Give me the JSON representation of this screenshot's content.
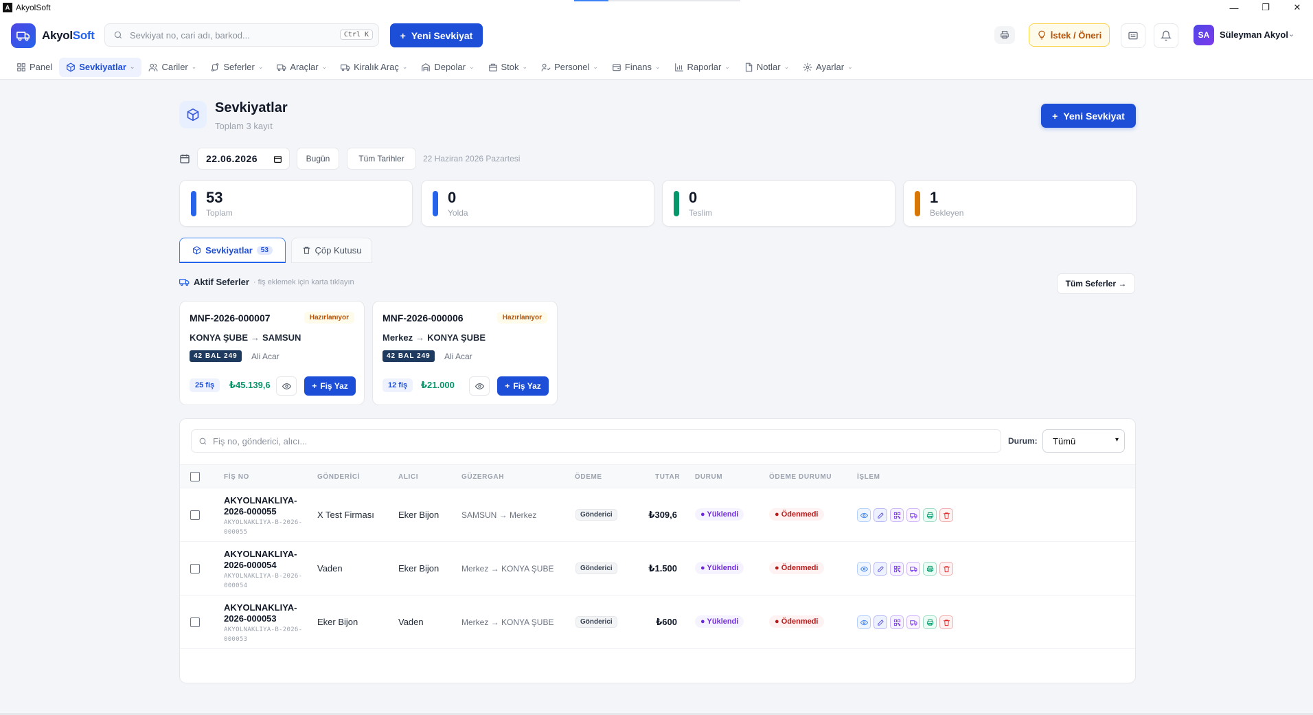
{
  "window": {
    "title": "AkyolSoft"
  },
  "header": {
    "logo_prefix": "Akyol",
    "logo_suffix": "Soft",
    "search_placeholder": "Sevkiyat no, cari adı, barkod...",
    "search_shortcut": "Ctrl K",
    "new_shipment": "Yeni Sevkiyat",
    "suggest": "İstek / Öneri",
    "user_initials": "SA",
    "user_name": "Süleyman Akyol"
  },
  "nav": [
    {
      "label": "Panel",
      "icon": "grid-icon",
      "chev": false
    },
    {
      "label": "Sevkiyatlar",
      "icon": "box-icon",
      "chev": true,
      "active": true
    },
    {
      "label": "Cariler",
      "icon": "users-icon",
      "chev": true
    },
    {
      "label": "Seferler",
      "icon": "route-icon",
      "chev": true
    },
    {
      "label": "Araçlar",
      "icon": "truck-icon",
      "chev": true
    },
    {
      "label": "Kiralık Araç",
      "icon": "truck-icon",
      "chev": true
    },
    {
      "label": "Depolar",
      "icon": "warehouse-icon",
      "chev": true
    },
    {
      "label": "Stok",
      "icon": "package-icon",
      "chev": true
    },
    {
      "label": "Personel",
      "icon": "user-icon",
      "chev": true
    },
    {
      "label": "Finans",
      "icon": "wallet-icon",
      "chev": true
    },
    {
      "label": "Raporlar",
      "icon": "chart-icon",
      "chev": true
    },
    {
      "label": "Notlar",
      "icon": "note-icon",
      "chev": true
    },
    {
      "label": "Ayarlar",
      "icon": "gear-icon",
      "chev": true
    }
  ],
  "page": {
    "title": "Sevkiyatlar",
    "subtitle": "Toplam 3 kayıt",
    "new_button": "Yeni Sevkiyat",
    "date_value": "22.06.2026",
    "today_button": "Bugün",
    "all_dates_button": "Tüm Tarihler",
    "date_label": "22 Haziran 2026 Pazartesi"
  },
  "stats": [
    {
      "value": "53",
      "label": "Toplam",
      "color": "#2563eb"
    },
    {
      "value": "0",
      "label": "Yolda",
      "color": "#2563eb"
    },
    {
      "value": "0",
      "label": "Teslim",
      "color": "#059669"
    },
    {
      "value": "1",
      "label": "Bekleyen",
      "color": "#d97706"
    }
  ],
  "tabs": {
    "shipments": "Sevkiyatlar",
    "shipments_count": "53",
    "trash": "Çöp Kutusu"
  },
  "active_trips": {
    "title": "Aktif Seferler",
    "hint": "· fiş eklemek için karta tıklayın",
    "all_button": "Tüm Seferler →",
    "cards": [
      {
        "code": "MNF-2026-000007",
        "status": "Hazırlanıyor",
        "from": "KONYA ŞUBE",
        "to": "SAMSUN",
        "plate": "42 BAL 249",
        "driver": "Ali Acar",
        "fis_count": "25 fiş",
        "amount": "₺45.139,6",
        "button": "Fiş Yaz"
      },
      {
        "code": "MNF-2026-000006",
        "status": "Hazırlanıyor",
        "from": "Merkez",
        "to": "KONYA ŞUBE",
        "plate": "42 BAL 249",
        "driver": "Ali Acar",
        "fis_count": "12 fiş",
        "amount": "₺21.000",
        "button": "Fiş Yaz"
      }
    ]
  },
  "table": {
    "search_placeholder": "Fiş no, gönderici, alıcı...",
    "status_label": "Durum:",
    "status_value": "Tümü",
    "columns": [
      "FİŞ NO",
      "GÖNDERİCİ",
      "ALICI",
      "GÜZERGAH",
      "ÖDEME",
      "TUTAR",
      "DURUM",
      "ÖDEME DURUMU",
      "İŞLEM"
    ],
    "rows": [
      {
        "fis_no": "AKYOLNAKLIYA-2026-000055",
        "fis_sub": "AKYOLNAKLIYA-B-2026-000055",
        "sender": "X Test Firması",
        "receiver": "Eker Bijon",
        "route": "SAMSUN → Merkez",
        "payment": "Gönderici",
        "amount": "₺309,6",
        "status": "Yüklendi",
        "pay_status": "Ödenmedi"
      },
      {
        "fis_no": "AKYOLNAKLIYA-2026-000054",
        "fis_sub": "AKYOLNAKLIYA-B-2026-000054",
        "sender": "Vaden",
        "receiver": "Eker Bijon",
        "route": "Merkez → KONYA ŞUBE",
        "payment": "Gönderici",
        "amount": "₺1.500",
        "status": "Yüklendi",
        "pay_status": "Ödenmedi"
      },
      {
        "fis_no": "AKYOLNAKLIYA-2026-000053",
        "fis_sub": "AKYOLNAKLIYA-B-2026-000053",
        "sender": "Eker Bijon",
        "receiver": "Vaden",
        "route": "Merkez → KONYA ŞUBE",
        "payment": "Gönderici",
        "amount": "₺600",
        "status": "Yüklendi",
        "pay_status": "Ödenmedi"
      }
    ]
  }
}
